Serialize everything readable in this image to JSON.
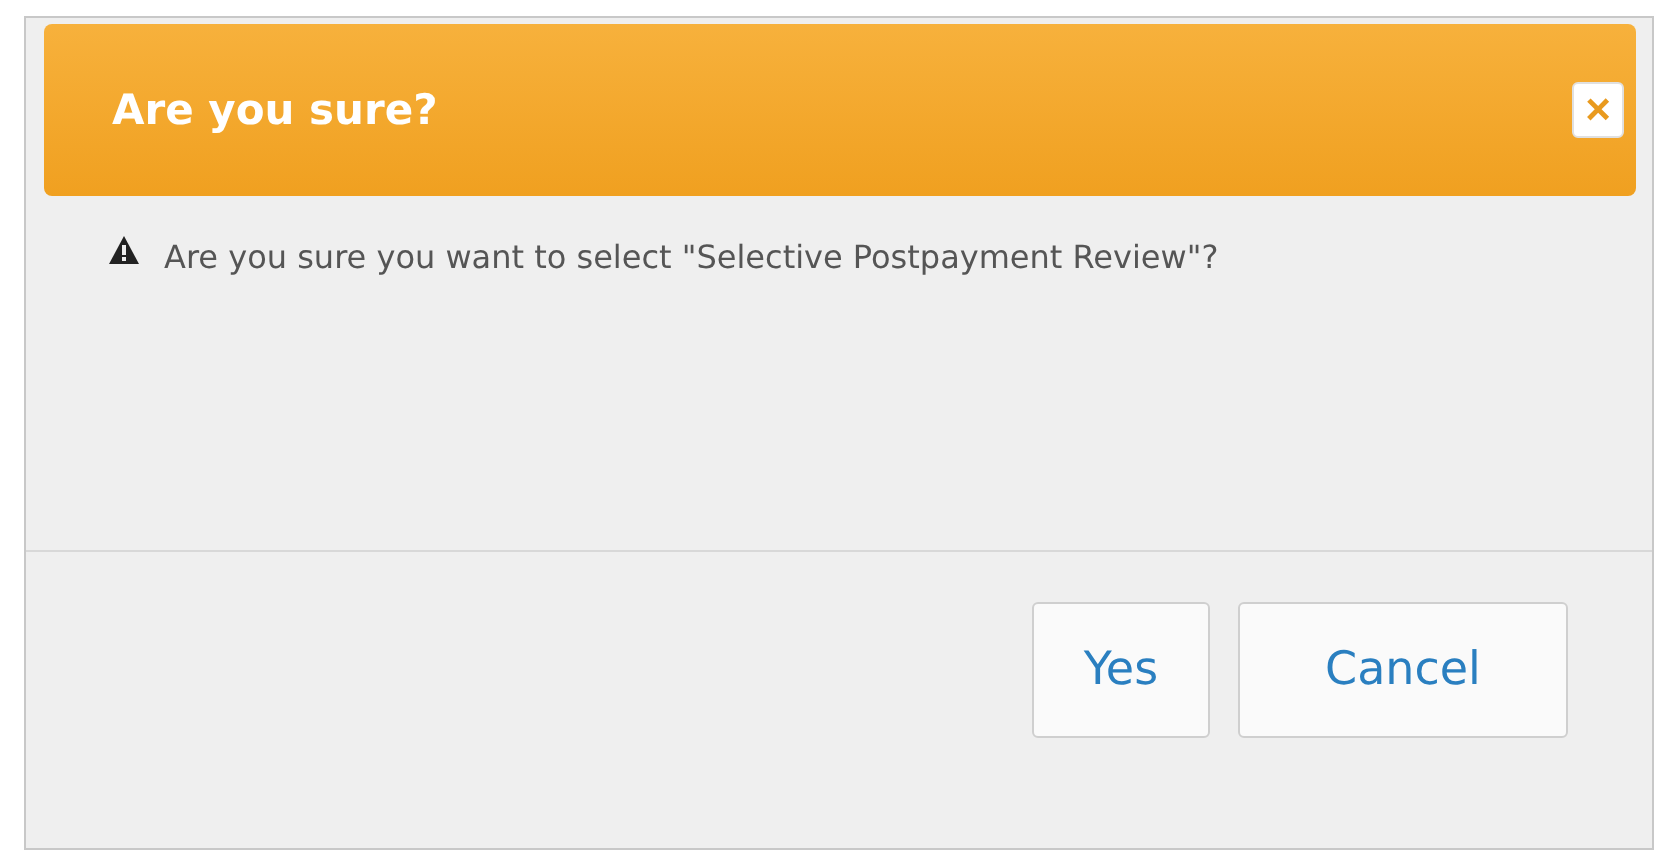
{
  "dialog": {
    "title": "Are you sure?",
    "close": "×",
    "message": "Are you sure you want to select \"Selective Postpayment Review\"?",
    "buttons": [
      "Yes",
      "Cancel"
    ]
  }
}
